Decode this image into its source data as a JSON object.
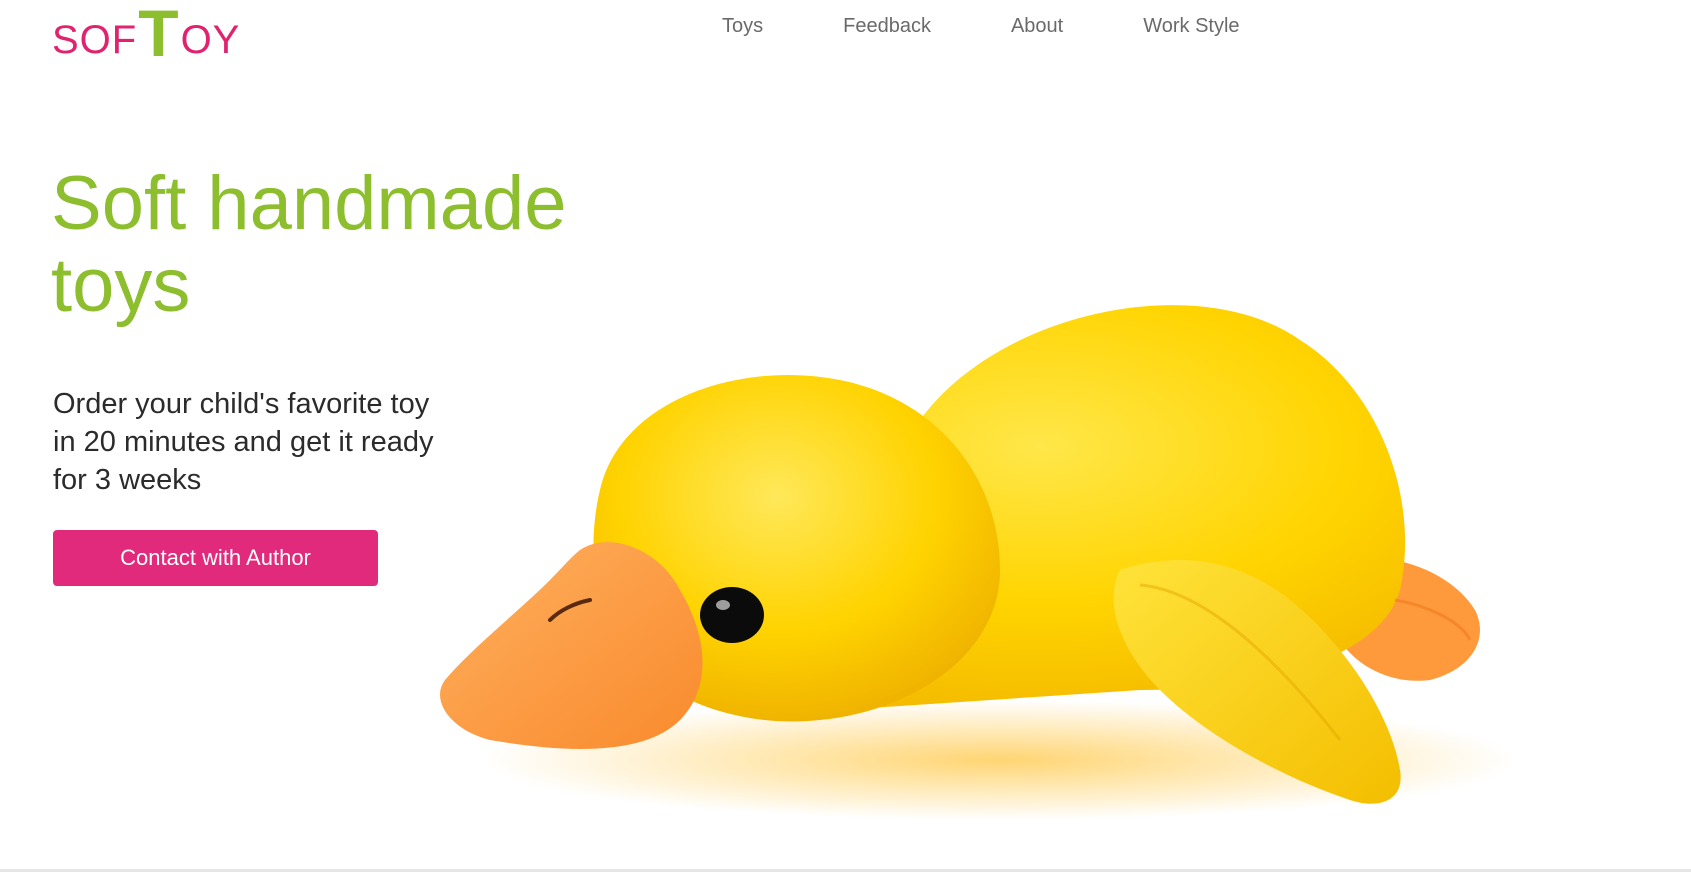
{
  "logo": {
    "part1": "SOF",
    "part2": "T",
    "part3": "OY"
  },
  "nav": {
    "items": [
      {
        "label": "Toys"
      },
      {
        "label": "Feedback"
      },
      {
        "label": "About"
      },
      {
        "label": "Work Style"
      }
    ]
  },
  "hero": {
    "title_line1": "Soft handmade",
    "title_line2": "toys",
    "subtitle_line1": "Order your child's favorite toy",
    "subtitle_line2": "in 20 minutes and get it ready",
    "subtitle_line3": "for 3 weeks",
    "cta_label": "Contact with Author"
  },
  "colors": {
    "brand_pink": "#e22a7c",
    "brand_green": "#8cbe2e",
    "duck_yellow": "#ffd400",
    "duck_orange": "#ff9a3c"
  },
  "icons": {
    "hero_image": "yellow-plush-duck-image"
  }
}
